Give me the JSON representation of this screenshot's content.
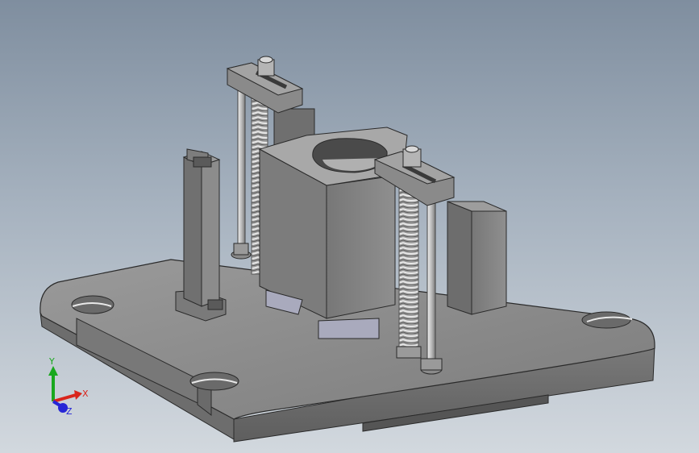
{
  "viewport": {
    "background_top": "#7f8e9f",
    "background_bottom": "#d2d8de"
  },
  "model": {
    "body_color": "#8a8a8a",
    "edge_color": "#2a2a2a",
    "highlight_color": "#c9c9c9",
    "recess_color": "#a9aabd"
  },
  "triad": {
    "x_label": "X",
    "y_label": "Y",
    "z_label": "Z",
    "x_color": "#d9251c",
    "y_color": "#19a81e",
    "z_color": "#2626d6"
  }
}
